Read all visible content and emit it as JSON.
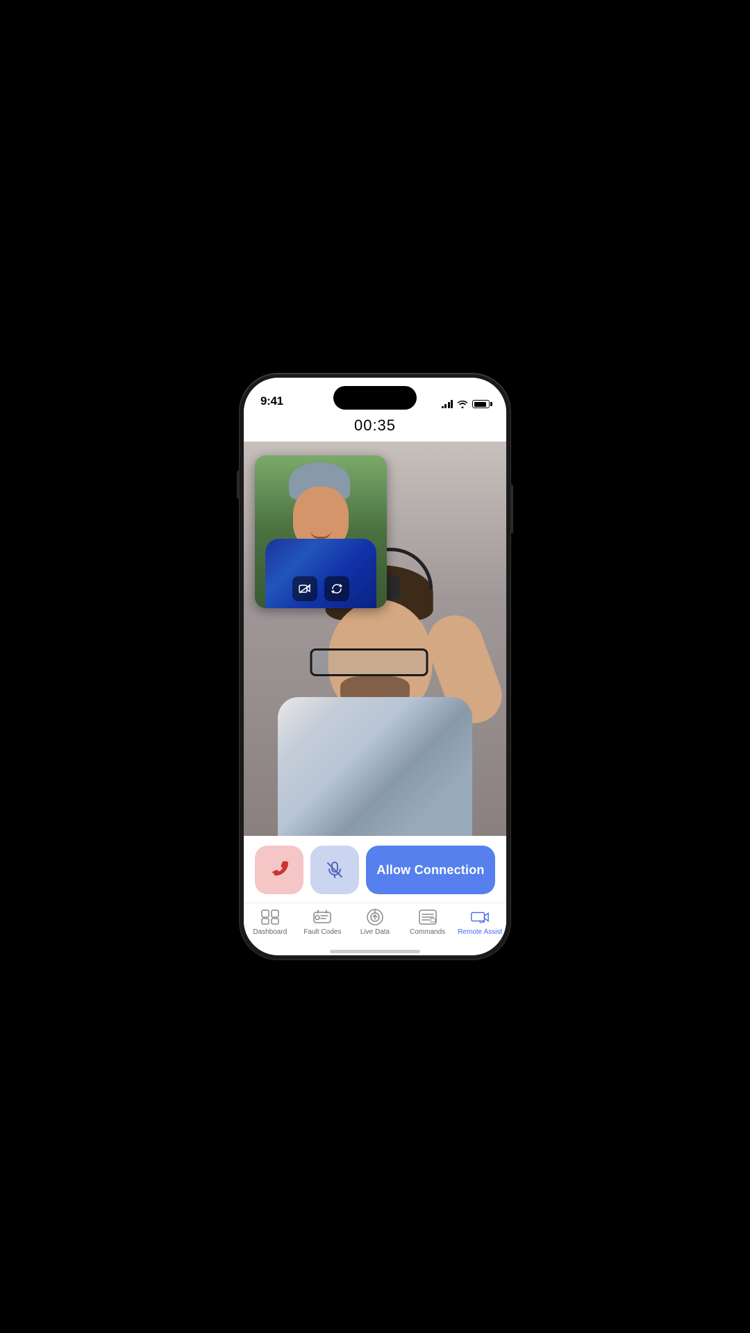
{
  "statusBar": {
    "time": "9:41",
    "signalBars": [
      3,
      6,
      9,
      12
    ],
    "battery": 85
  },
  "callTimer": {
    "display": "00:35"
  },
  "smallVideo": {
    "cameraOffLabel": "camera-off",
    "flipLabel": "flip-camera"
  },
  "callControls": {
    "endCallLabel": "",
    "muteLabel": "",
    "allowConnectionLabel": "Allow Connection"
  },
  "tabBar": {
    "items": [
      {
        "id": "dashboard",
        "label": "Dashboard",
        "active": false
      },
      {
        "id": "fault-codes",
        "label": "Fault Codes",
        "active": false
      },
      {
        "id": "live-data",
        "label": "Live Data",
        "active": false
      },
      {
        "id": "commands",
        "label": "Commands",
        "active": false
      },
      {
        "id": "remote-assist",
        "label": "Remote Assist",
        "active": true
      }
    ]
  }
}
